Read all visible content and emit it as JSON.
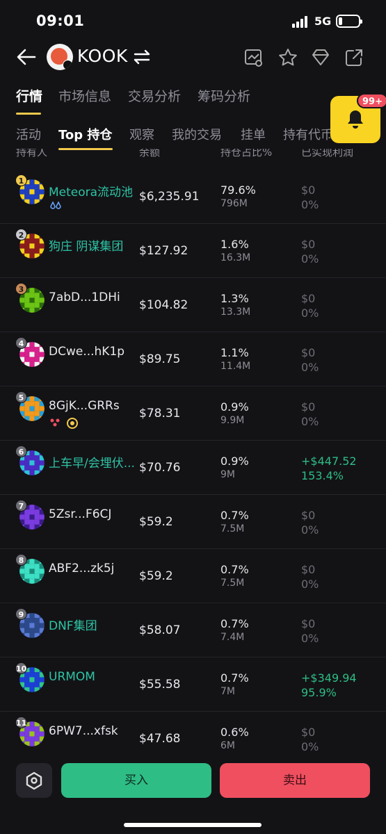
{
  "status": {
    "time": "09:01",
    "network": "5G",
    "battery_level": 0.2
  },
  "header": {
    "token_name": "KOOK"
  },
  "tabs_main": [
    {
      "label": "行情",
      "active": true
    },
    {
      "label": "市场信息",
      "active": false
    },
    {
      "label": "交易分析",
      "active": false
    },
    {
      "label": "筹码分析",
      "active": false
    }
  ],
  "notification": {
    "badge": "99+"
  },
  "tabs_sub": [
    {
      "label": "活动",
      "active": false
    },
    {
      "label": "Top 持仓",
      "active": true
    },
    {
      "label": "观察",
      "active": false
    },
    {
      "label": "我的交易",
      "active": false
    },
    {
      "label": "挂单",
      "active": false
    },
    {
      "label": "持有代币",
      "active": false
    }
  ],
  "columns": {
    "holder": "持有人",
    "balance": "余额",
    "share": "持仓占比%",
    "realized": "已实现利润"
  },
  "holders": [
    {
      "rank": "1",
      "name": "Meteora流动池",
      "link": true,
      "amount": "$6,235.91",
      "pct": "79.6%",
      "tokens": "796M",
      "profit": "$0",
      "profit_pct": "0%",
      "up": false,
      "avatar": [
        "#1f3fbf",
        "#f2d11c"
      ]
    },
    {
      "rank": "2",
      "name": "狗庄 阴谋集团",
      "link": true,
      "amount": "$127.92",
      "pct": "1.6%",
      "tokens": "16.3M",
      "profit": "$0",
      "profit_pct": "0%",
      "up": false,
      "avatar": [
        "#8a1c1c",
        "#f2d11c"
      ]
    },
    {
      "rank": "3",
      "name": "7abD...1DHi",
      "link": false,
      "amount": "$104.82",
      "pct": "1.3%",
      "tokens": "13.3M",
      "profit": "$0",
      "profit_pct": "0%",
      "up": false,
      "avatar": [
        "#6cc414",
        "#2a6b0c"
      ]
    },
    {
      "rank": "4",
      "name": "DCwe...hK1p",
      "link": false,
      "amount": "$89.75",
      "pct": "1.1%",
      "tokens": "11.4M",
      "profit": "$0",
      "profit_pct": "0%",
      "up": false,
      "avatar": [
        "#d9208c",
        "#f2f2f2"
      ]
    },
    {
      "rank": "5",
      "name": "8GjK...GRRs",
      "link": false,
      "amount": "$78.31",
      "pct": "0.9%",
      "tokens": "9.9M",
      "profit": "$0",
      "profit_pct": "0%",
      "up": false,
      "avatar": [
        "#f29a1c",
        "#2a9fd6"
      ]
    },
    {
      "rank": "6",
      "name": "上车早/会埋伏...",
      "link": true,
      "amount": "$70.76",
      "pct": "0.9%",
      "tokens": "9M",
      "profit": "+$447.52",
      "profit_pct": "153.4%",
      "up": true,
      "avatar": [
        "#4a2cc4",
        "#2ec4d6"
      ]
    },
    {
      "rank": "7",
      "name": "5Zsr...F6CJ",
      "link": false,
      "amount": "$59.2",
      "pct": "0.7%",
      "tokens": "7.5M",
      "profit": "$0",
      "profit_pct": "0%",
      "up": false,
      "avatar": [
        "#7a3ce0",
        "#3a1c8a"
      ]
    },
    {
      "rank": "8",
      "name": "ABF2...zk5j",
      "link": false,
      "amount": "$59.2",
      "pct": "0.7%",
      "tokens": "7.5M",
      "profit": "$0",
      "profit_pct": "0%",
      "up": false,
      "avatar": [
        "#3ce0c4",
        "#1c8a7a"
      ]
    },
    {
      "rank": "9",
      "name": "DNF集团",
      "link": true,
      "amount": "$58.07",
      "pct": "0.7%",
      "tokens": "7.4M",
      "profit": "$0",
      "profit_pct": "0%",
      "up": false,
      "avatar": [
        "#2c4a8a",
        "#5a7ad6"
      ]
    },
    {
      "rank": "10",
      "name": "URMOM",
      "link": true,
      "amount": "$55.58",
      "pct": "0.7%",
      "tokens": "7M",
      "profit": "+$349.94",
      "profit_pct": "95.9%",
      "up": true,
      "avatar": [
        "#1c3fd6",
        "#2ec48a"
      ]
    },
    {
      "rank": "11",
      "name": "6PW7...xfsk",
      "link": false,
      "amount": "$47.68",
      "pct": "0.6%",
      "tokens": "6M",
      "profit": "$0",
      "profit_pct": "0%",
      "up": false,
      "avatar": [
        "#7a3ce0",
        "#9ac41c"
      ]
    }
  ],
  "actions": {
    "buy": "买入",
    "sell": "卖出"
  }
}
